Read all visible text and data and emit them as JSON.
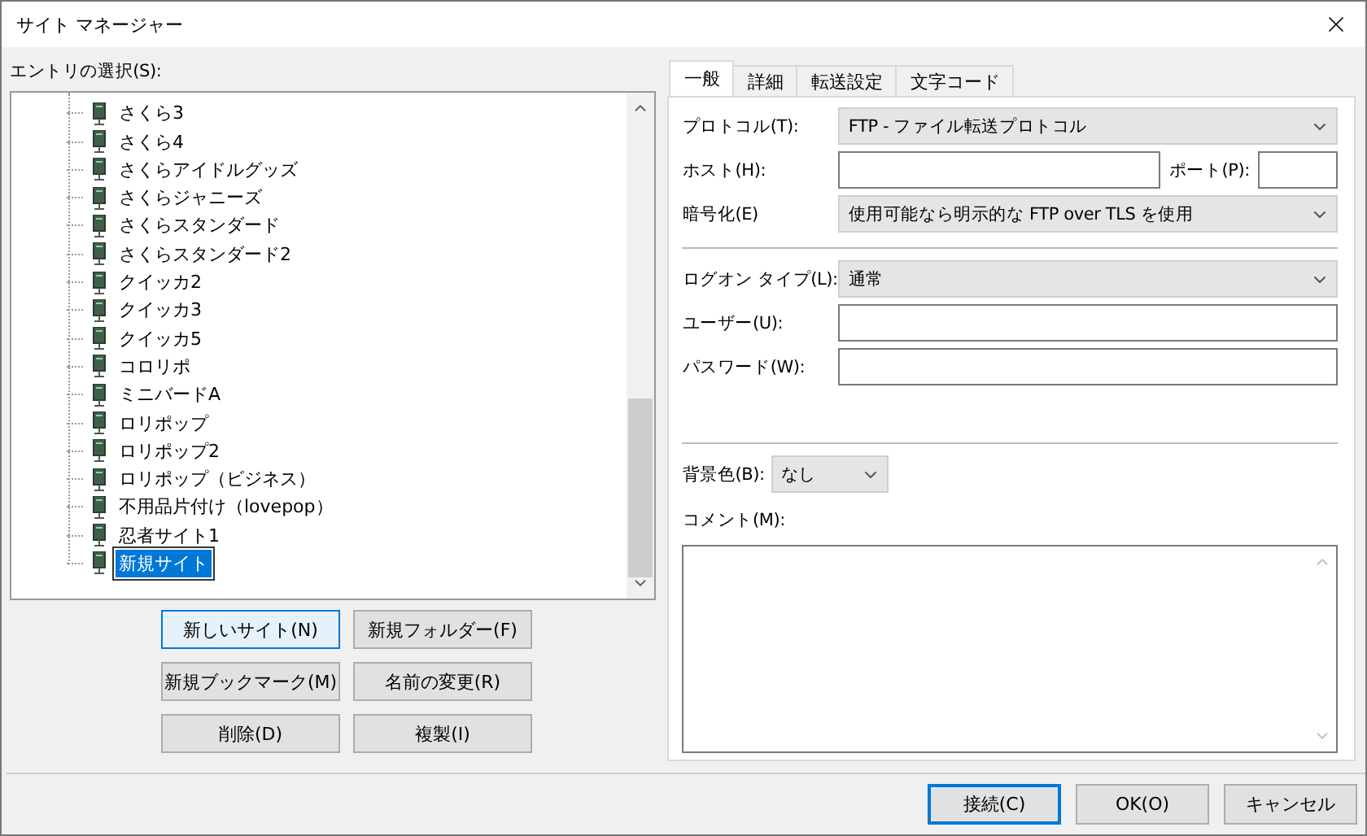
{
  "window": {
    "title": "サイト マネージャー"
  },
  "tree": {
    "label": "エントリの選択(S):",
    "items": [
      {
        "label": "さくら3",
        "selected": false
      },
      {
        "label": "さくら4",
        "selected": false
      },
      {
        "label": "さくらアイドルグッズ",
        "selected": false
      },
      {
        "label": "さくらジャニーズ",
        "selected": false
      },
      {
        "label": "さくらスタンダード",
        "selected": false
      },
      {
        "label": "さくらスタンダード2",
        "selected": false
      },
      {
        "label": "クイッカ2",
        "selected": false
      },
      {
        "label": "クイッカ3",
        "selected": false
      },
      {
        "label": "クイッカ5",
        "selected": false
      },
      {
        "label": "コロリポ",
        "selected": false
      },
      {
        "label": "ミニバードA",
        "selected": false
      },
      {
        "label": "ロリポップ",
        "selected": false
      },
      {
        "label": "ロリポップ2",
        "selected": false
      },
      {
        "label": "ロリポップ（ビジネス）",
        "selected": false
      },
      {
        "label": "不用品片付け（lovepop）",
        "selected": false
      },
      {
        "label": "忍者サイト1",
        "selected": false
      },
      {
        "label": "新規サイト",
        "selected": true
      }
    ]
  },
  "tree_buttons": [
    {
      "label": "新しいサイト(N)",
      "default": true
    },
    {
      "label": "新規フォルダー(F)",
      "default": false
    },
    {
      "label": "新規ブックマーク(M)",
      "default": false
    },
    {
      "label": "名前の変更(R)",
      "default": false
    },
    {
      "label": "削除(D)",
      "default": false
    },
    {
      "label": "複製(I)",
      "default": false
    }
  ],
  "tabs": [
    {
      "label": "一般",
      "selected": true
    },
    {
      "label": "詳細",
      "selected": false
    },
    {
      "label": "転送設定",
      "selected": false
    },
    {
      "label": "文字コード",
      "selected": false
    }
  ],
  "general": {
    "protocol": {
      "label": "プロトコル(T):",
      "value": "FTP - ファイル転送プロトコル"
    },
    "host": {
      "label": "ホスト(H):"
    },
    "port": {
      "label": "ポート(P):"
    },
    "encryption": {
      "label": "暗号化(E)",
      "value": "使用可能なら明示的な FTP over TLS を使用"
    },
    "logon_type": {
      "label": "ログオン タイプ(L):",
      "value": "通常"
    },
    "user": {
      "label": "ユーザー(U):"
    },
    "password": {
      "label": "パスワード(W):"
    },
    "background_color": {
      "label": "背景色(B):",
      "value": "なし"
    },
    "comment": {
      "label": "コメント(M):"
    }
  },
  "footer_buttons": [
    {
      "label": "接続(C)",
      "default": true
    },
    {
      "label": "OK(O)",
      "default": false
    },
    {
      "label": "キャンセル",
      "default": false
    }
  ]
}
